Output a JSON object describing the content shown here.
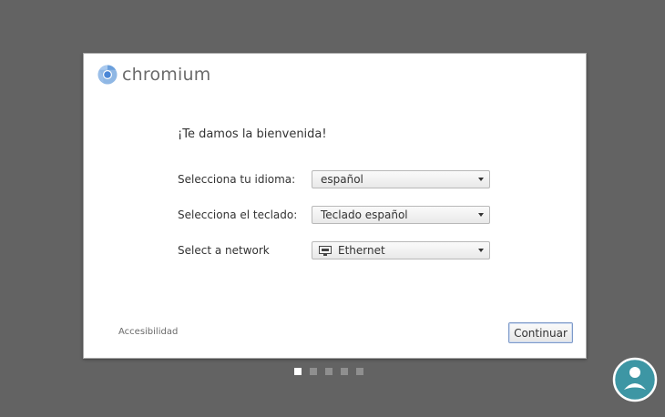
{
  "brand": {
    "name": "chromium",
    "logo_icon": "chromium-logo"
  },
  "welcome_text": "¡Te damos la bienvenida!",
  "language": {
    "label": "Selecciona tu idioma:",
    "value": "español"
  },
  "keyboard": {
    "label": "Selecciona el teclado:",
    "value": "Teclado español"
  },
  "network": {
    "label": "Select a network",
    "value": "Ethernet",
    "icon": "ethernet-icon"
  },
  "footer": {
    "accessibility_label": "Accesibilidad",
    "continue_label": "Continuar"
  },
  "pager": {
    "total": 5,
    "active_index": 0
  },
  "colors": {
    "background": "#636363",
    "dialog": "#ffffff",
    "accent_border": "#7e9ac9",
    "badge": "#3d96a4"
  }
}
